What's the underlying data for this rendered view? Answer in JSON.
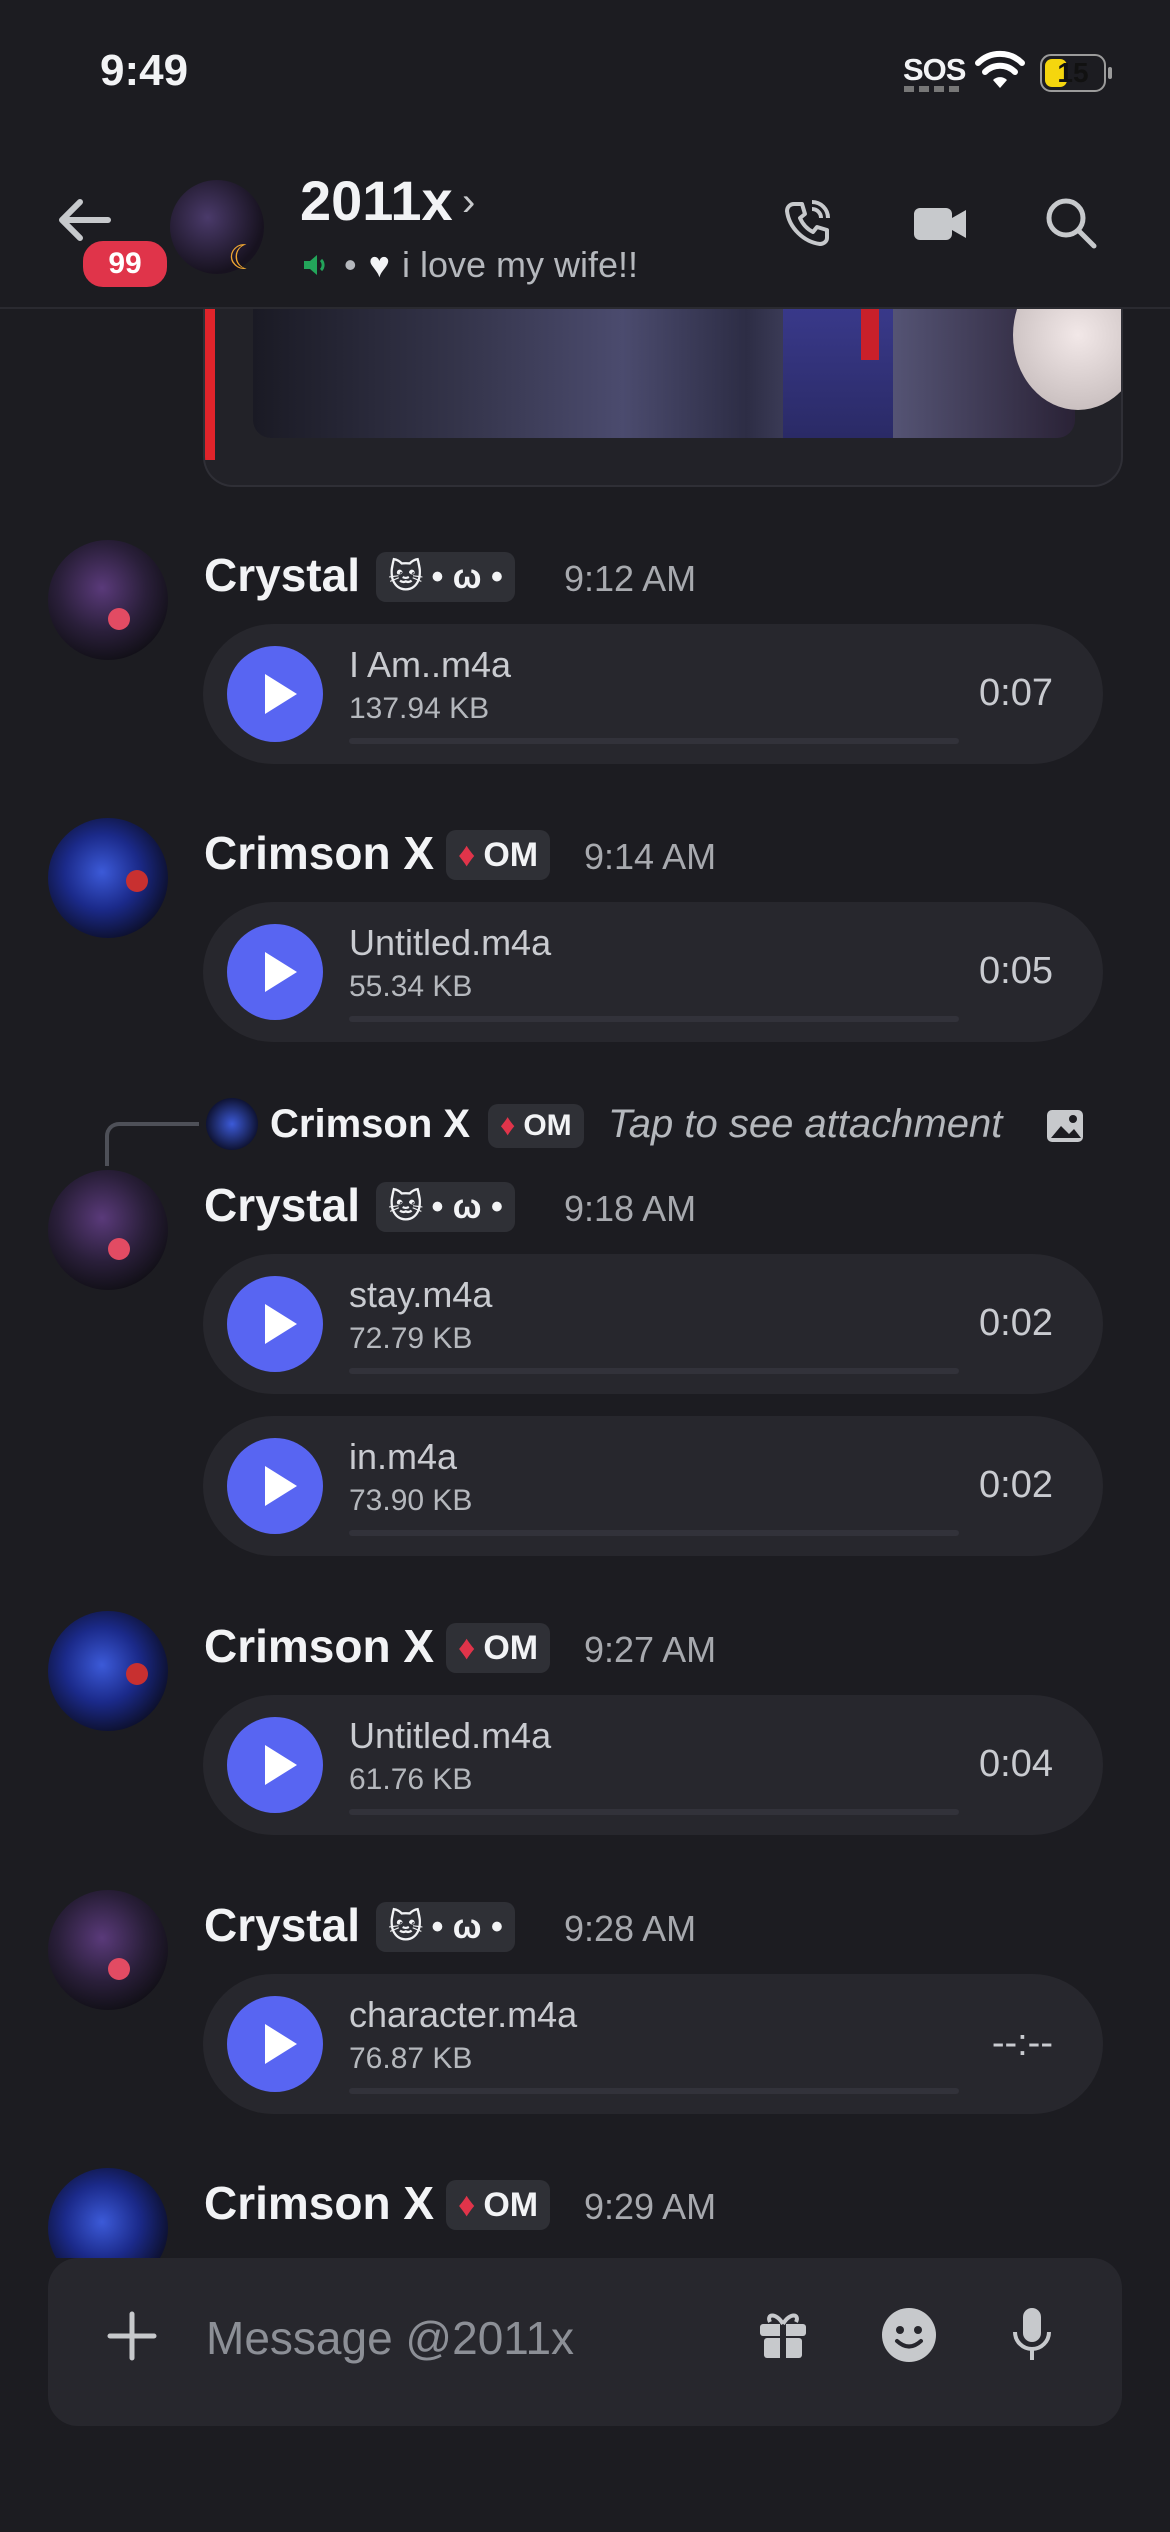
{
  "status_bar": {
    "time": "9:49",
    "sos": "SOS",
    "battery": "15",
    "battery_color": "#f5d60e"
  },
  "header": {
    "unread_badge": "99",
    "title": "2011x",
    "status_text": "i love my wife!!",
    "icons": [
      "back-arrow-icon",
      "voice-call-icon",
      "video-call-icon",
      "search-icon"
    ]
  },
  "messages": [
    {
      "author": "Crystal",
      "tag": "• ω •",
      "time": "9:12 AM",
      "attachments": [
        {
          "filename": "I Am..m4a",
          "size": "137.94 KB",
          "duration": "0:07"
        }
      ]
    },
    {
      "author": "Crimson X",
      "tag": "OM",
      "time": "9:14 AM",
      "attachments": [
        {
          "filename": "Untitled.m4a",
          "size": "55.34 KB",
          "duration": "0:05"
        }
      ]
    },
    {
      "reply": {
        "author": "Crimson X",
        "tag": "OM",
        "text": "Tap to see attachment"
      },
      "author": "Crystal",
      "tag": "• ω •",
      "time": "9:18 AM",
      "attachments": [
        {
          "filename": "stay.m4a",
          "size": "72.79 KB",
          "duration": "0:02"
        },
        {
          "filename": "in.m4a",
          "size": "73.90 KB",
          "duration": "0:02"
        }
      ]
    },
    {
      "author": "Crimson X",
      "tag": "OM",
      "time": "9:27 AM",
      "attachments": [
        {
          "filename": "Untitled.m4a",
          "size": "61.76 KB",
          "duration": "0:04"
        }
      ]
    },
    {
      "author": "Crystal",
      "tag": "• ω •",
      "time": "9:28 AM",
      "attachments": [
        {
          "filename": "character.m4a",
          "size": "76.87 KB",
          "duration": "--:--"
        }
      ]
    },
    {
      "author": "Crimson X",
      "tag": "OM",
      "time": "9:29 AM",
      "attachments": []
    }
  ],
  "composer": {
    "placeholder": "Message @2011x"
  },
  "colors": {
    "accent": "#5865f2",
    "badge": "#e0344a",
    "background": "#1c1c21"
  }
}
